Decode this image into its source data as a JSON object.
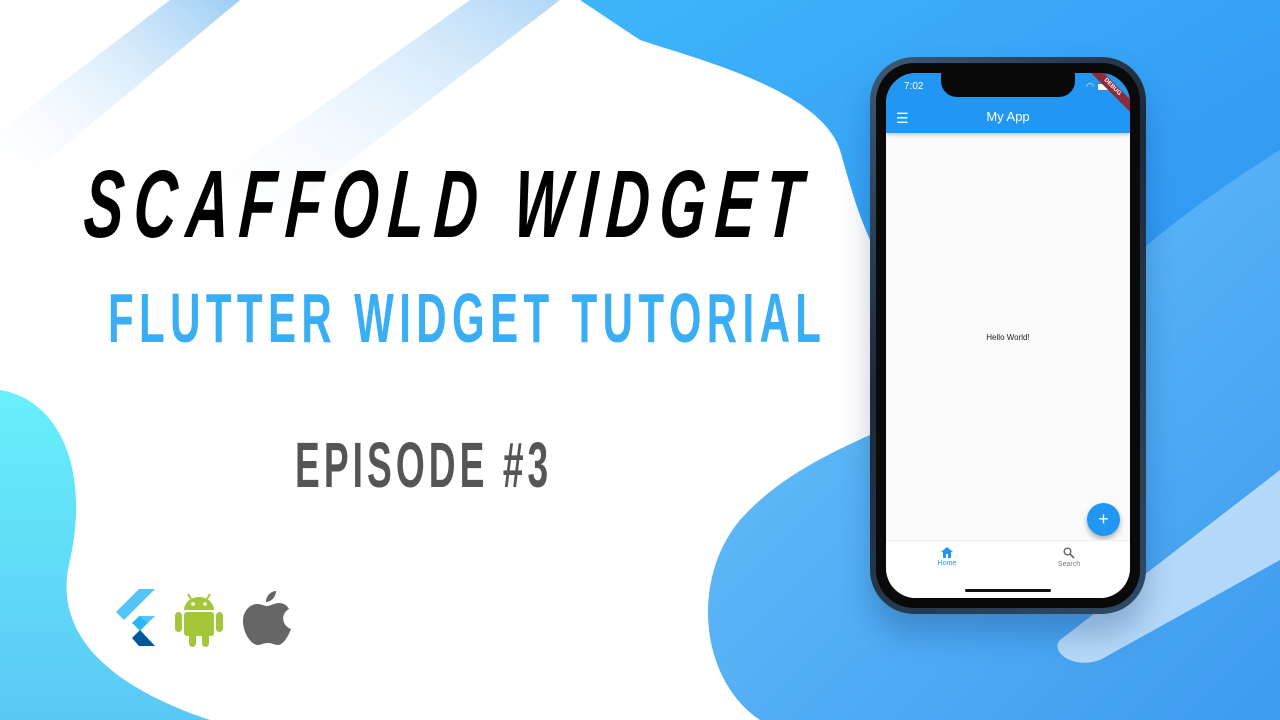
{
  "headline": "SCAFFOLD WIDGET",
  "subtitle": "FLUTTER WIDGET TUTORIAL",
  "episode": "EPISODE #3",
  "logos": [
    "flutter-logo",
    "android-logo",
    "apple-logo"
  ],
  "phone": {
    "time": "7:02",
    "debug_banner": "DEBUG",
    "app_title": "My App",
    "body_text": "Hello World!",
    "fab_label": "+",
    "nav": [
      {
        "label": "Home",
        "icon": "home-icon"
      },
      {
        "label": "Search",
        "icon": "search-icon"
      }
    ]
  },
  "colors": {
    "accent": "#2196f3",
    "subtitle": "#3aaef5",
    "episode": "#555555"
  }
}
